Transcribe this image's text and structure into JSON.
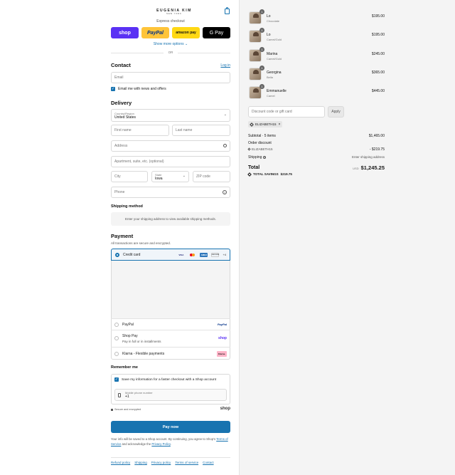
{
  "brand": {
    "name": "EUGENIA KIM",
    "tagline": "NEW YORK"
  },
  "express": {
    "title": "Express checkout",
    "buttons": [
      {
        "label": "shop",
        "bg": "#5a31f4",
        "fg": "#ffffff"
      },
      {
        "label": "PayPal",
        "bg": "#ffc439",
        "fg": "#003087"
      },
      {
        "label": "amazon pay",
        "bg": "#ffd814",
        "fg": "#111111"
      },
      {
        "label": "G Pay",
        "bg": "#000000",
        "fg": "#ffffff"
      }
    ],
    "show_more": "Show more options",
    "or": "OR"
  },
  "contact": {
    "title": "Contact",
    "login": "Log in",
    "email_placeholder": "Email",
    "news_label": "Email me with news and offers"
  },
  "delivery": {
    "title": "Delivery",
    "country_label": "Country/Region",
    "country_value": "United States",
    "first_name": "First name",
    "last_name": "Last name",
    "address": "Address",
    "apartment": "Apartment, suite, etc. (optional)",
    "city": "City",
    "state_label": "State",
    "state_value": "Iowa",
    "zip": "ZIP code",
    "phone": "Phone"
  },
  "shipping_method": {
    "title": "Shipping method",
    "note": "Enter your shipping address to view available shipping methods."
  },
  "payment": {
    "title": "Payment",
    "subtitle": "All transactions are secure and encrypted.",
    "credit_card": "Credit card",
    "card_brands": [
      "VISA",
      "MC",
      "AMEX",
      "DISCOVER"
    ],
    "more_cards": "+4",
    "paypal": "PayPal",
    "paypal_logo": "PayPal",
    "shoppay": "Shop Pay",
    "shoppay_sub": "Pay in full or in installments",
    "shoppay_logo": "shop",
    "klarna": "Klarna - Flexible payments",
    "klarna_logo": "Klarna."
  },
  "remember": {
    "title": "Remember me",
    "save_label": "Save my information for a faster checkout with a Shop account",
    "mobile_label": "Mobile phone number",
    "mobile_value": "+1",
    "secure": "Secure and encrypted",
    "shop_logo": "shop"
  },
  "pay_now": "Pay now",
  "legal": {
    "text1": "Your info will be saved to a Shop account. By continuing, you agree to Shop's",
    "tos": "Terms of Service",
    "text2": "and acknowledge the",
    "privacy": "Privacy Policy",
    "end": "."
  },
  "footer_links": [
    "Refund policy",
    "Shipping",
    "Privacy policy",
    "Terms of service",
    "Contact"
  ],
  "cart": {
    "items": [
      {
        "qty": "1",
        "name": "Lo",
        "variant": "Chocolate",
        "price": "$195.00"
      },
      {
        "qty": "1",
        "name": "Lo",
        "variant": "Camel/Gold",
        "price": "$195.00"
      },
      {
        "qty": "1",
        "name": "Marina",
        "variant": "Camel/Gold",
        "price": "$245.00"
      },
      {
        "qty": "1",
        "name": "Georgina",
        "variant": "Bella",
        "price": "$365.00"
      },
      {
        "qty": "1",
        "name": "Emmanuelle",
        "variant": "Camel",
        "price": "$445.00"
      }
    ],
    "discount_placeholder": "Discount code or gift card",
    "apply": "Apply",
    "code_tag": "ELIZABETH15",
    "subtotal_label": "Subtotal · 5 items",
    "subtotal_value": "$1,465.00",
    "order_discount": "Order discount",
    "discount_code": "ELIZABETH15",
    "discount_value": "- $219.75",
    "shipping_label": "Shipping",
    "shipping_value": "Enter shipping address",
    "total_label": "Total",
    "currency": "USD",
    "total_value": "$1,245.25",
    "savings_label": "TOTAL SAVINGS",
    "savings_value": "$219.75"
  }
}
